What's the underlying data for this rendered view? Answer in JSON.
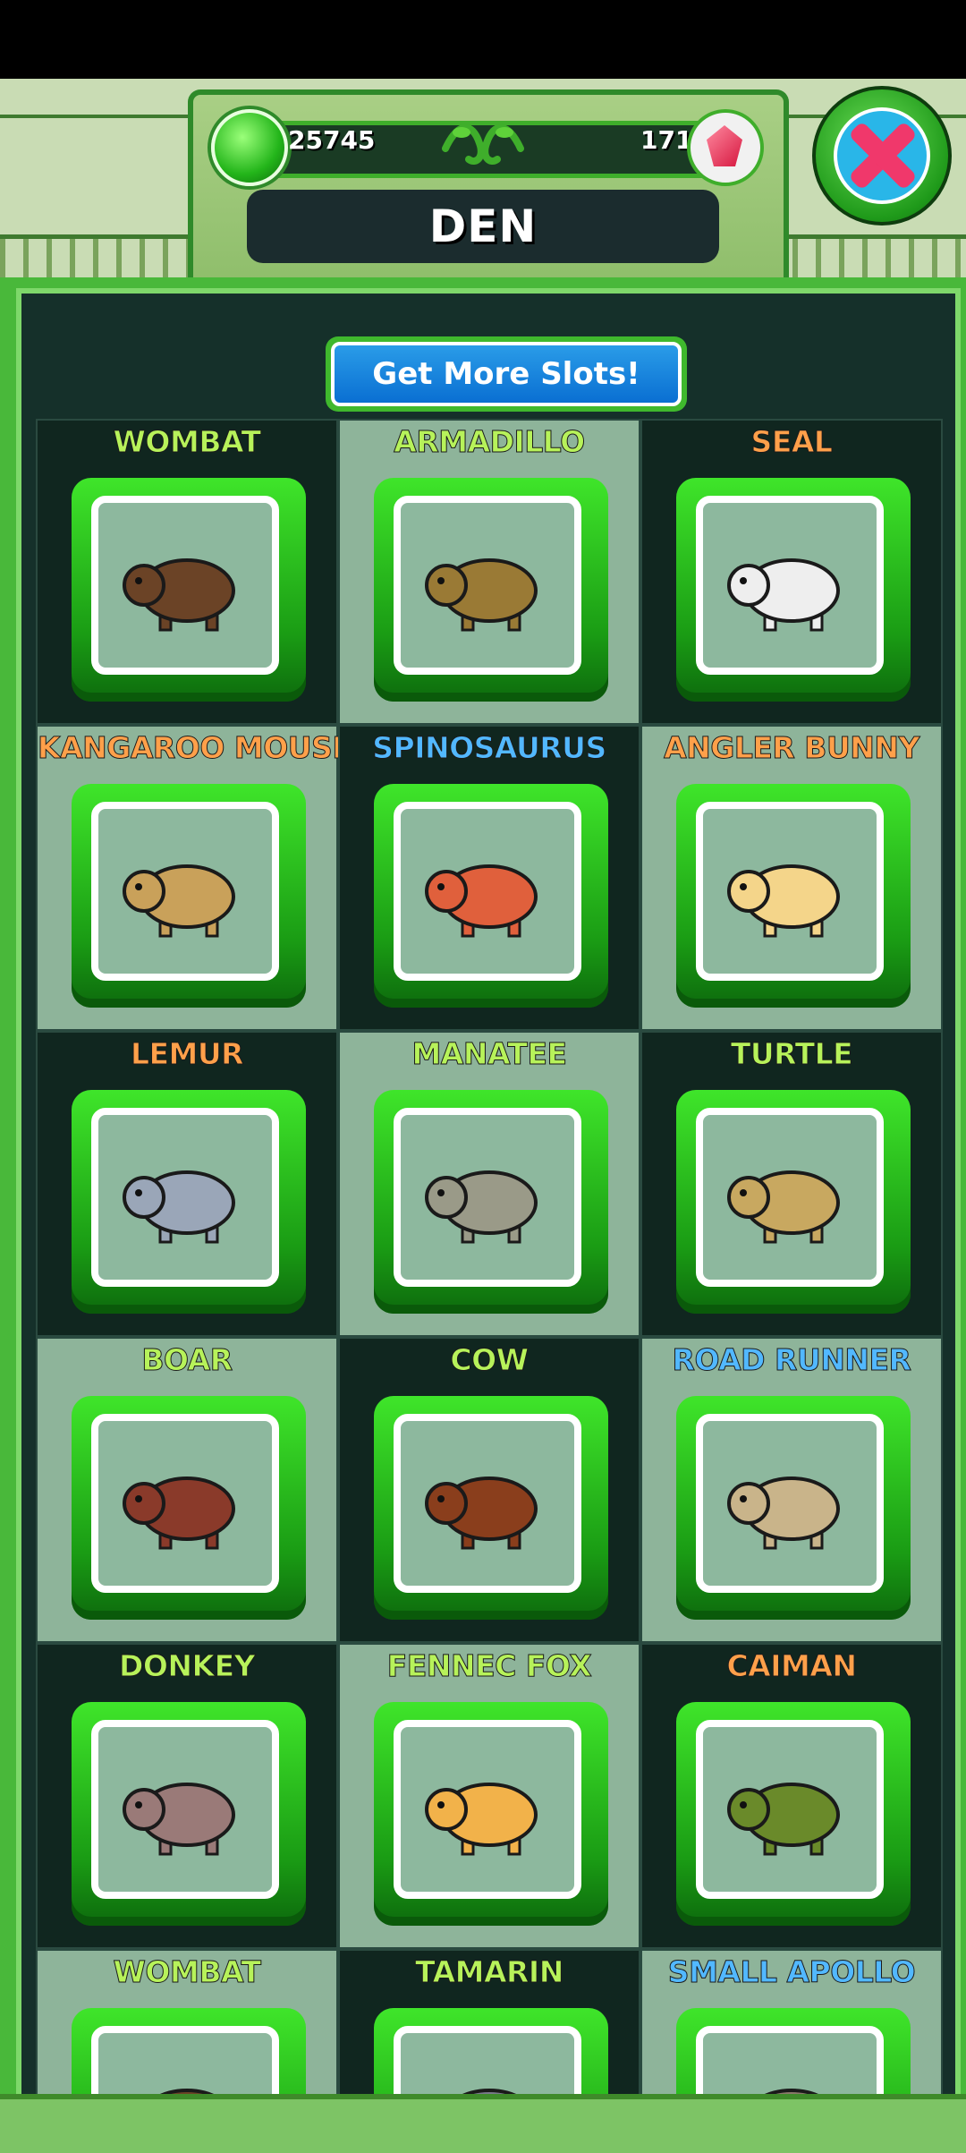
{
  "header": {
    "gems": "25745",
    "rubies": "171",
    "title": "DEN"
  },
  "actions": {
    "get_more_slots": "Get More Slots!"
  },
  "animals": [
    {
      "name": "WOMBAT",
      "color": "#b7f25a",
      "icon": "wombat-icon",
      "body": "#6b4326",
      "shade": "dark"
    },
    {
      "name": "ARMADILLO",
      "color": "#b7f25a",
      "icon": "armadillo-icon",
      "body": "#9a7a35",
      "shade": "light"
    },
    {
      "name": "SEAL",
      "color": "#ffa04a",
      "icon": "seal-icon",
      "body": "#eeeeee",
      "shade": "dark"
    },
    {
      "name": "KANGAROO MOUSE",
      "color": "#ffa04a",
      "icon": "kangaroo-mouse-icon",
      "body": "#c9a15a",
      "shade": "light"
    },
    {
      "name": "SPINOSAURUS",
      "color": "#52b8ff",
      "icon": "spinosaurus-icon",
      "body": "#e0603c",
      "shade": "dark"
    },
    {
      "name": "ANGLER BUNNY",
      "color": "#ffa04a",
      "icon": "angler-bunny-icon",
      "body": "#f4d58a",
      "shade": "light"
    },
    {
      "name": "LEMUR",
      "color": "#ffa04a",
      "icon": "lemur-icon",
      "body": "#9aa6b8",
      "shade": "dark"
    },
    {
      "name": "MANATEE",
      "color": "#b7f25a",
      "icon": "manatee-icon",
      "body": "#9a9a88",
      "shade": "light"
    },
    {
      "name": "TURTLE",
      "color": "#b7f25a",
      "icon": "turtle-icon",
      "body": "#c8a860",
      "shade": "dark"
    },
    {
      "name": "BOAR",
      "color": "#b7f25a",
      "icon": "boar-icon",
      "body": "#8a3a2a",
      "shade": "light"
    },
    {
      "name": "COW",
      "color": "#b7f25a",
      "icon": "cow-icon",
      "body": "#8a3e1c",
      "shade": "dark"
    },
    {
      "name": "ROAD RUNNER",
      "color": "#52b8ff",
      "icon": "road-runner-icon",
      "body": "#c9b48a",
      "shade": "light"
    },
    {
      "name": "DONKEY",
      "color": "#b7f25a",
      "icon": "donkey-icon",
      "body": "#9a7a78",
      "shade": "dark"
    },
    {
      "name": "FENNEC FOX",
      "color": "#b7f25a",
      "icon": "fennec-fox-icon",
      "body": "#f2b24a",
      "shade": "light"
    },
    {
      "name": "CAIMAN",
      "color": "#ffa04a",
      "icon": "caiman-icon",
      "body": "#6a8a2a",
      "shade": "dark"
    },
    {
      "name": "WOMBAT",
      "color": "#b7f25a",
      "icon": "wombat-icon",
      "body": "#6b4326",
      "shade": "light"
    },
    {
      "name": "TAMARIN",
      "color": "#b7f25a",
      "icon": "tamarin-icon",
      "body": "#7a7a8a",
      "shade": "dark"
    },
    {
      "name": "SMALL APOLLO",
      "color": "#52b8ff",
      "icon": "small-apollo-icon",
      "body": "#8a7a6a",
      "shade": "light"
    }
  ]
}
